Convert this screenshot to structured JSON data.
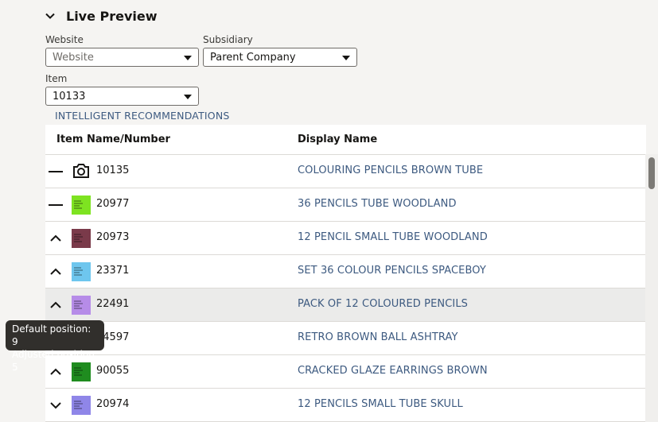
{
  "section": {
    "title": "Live Preview"
  },
  "website": {
    "label": "Website",
    "value": "Website"
  },
  "subsidiary": {
    "label": "Subsidiary",
    "value": "Parent Company"
  },
  "item": {
    "label": "Item",
    "value": "10133"
  },
  "recommendations": {
    "title": "INTELLIGENT RECOMMENDATIONS",
    "columns": [
      "Item Name/Number",
      "Display Name"
    ],
    "rows": [
      {
        "position_icon": "dash-icon",
        "thumb_icon": "camera-icon",
        "thumb_color": "",
        "number": "10135",
        "display_name": "COLOURING PENCILS BROWN TUBE"
      },
      {
        "position_icon": "dash-icon",
        "thumb_icon": "product-thumbnail",
        "thumb_color": "#7ee321",
        "number": "20977",
        "display_name": "36 PENCILS TUBE WOODLAND"
      },
      {
        "position_icon": "chevron-up-icon",
        "thumb_icon": "product-thumbnail",
        "thumb_color": "#7a3a4a",
        "number": "20973",
        "display_name": "12 PENCIL SMALL TUBE WOODLAND"
      },
      {
        "position_icon": "chevron-up-icon",
        "thumb_icon": "product-thumbnail",
        "thumb_color": "#6ec6ee",
        "number": "23371",
        "display_name": "SET 36 COLOUR PENCILS SPACEBOY"
      },
      {
        "position_icon": "chevron-up-icon",
        "thumb_icon": "product-thumbnail",
        "thumb_color": "#b68ce8",
        "number": "22491",
        "display_name": "PACK OF 12 COLOURED PENCILS"
      },
      {
        "position_icon": "chevron-up-icon",
        "thumb_icon": "product-thumbnail",
        "thumb_color": "#2f2f2f",
        "number": "84597",
        "display_name": "RETRO BROWN BALL ASHTRAY"
      },
      {
        "position_icon": "chevron-up-icon",
        "thumb_icon": "product-thumbnail",
        "thumb_color": "#1f8c1f",
        "number": "90055",
        "display_name": "CRACKED GLAZE EARRINGS BROWN"
      },
      {
        "position_icon": "chevron-down-icon",
        "thumb_icon": "product-thumbnail",
        "thumb_color": "#8f86e8",
        "number": "20974",
        "display_name": "12 PENCILS SMALL TUBE SKULL"
      }
    ]
  },
  "tooltip": {
    "line1": "Default position: 9",
    "line2": "Adjusted position: 5"
  }
}
